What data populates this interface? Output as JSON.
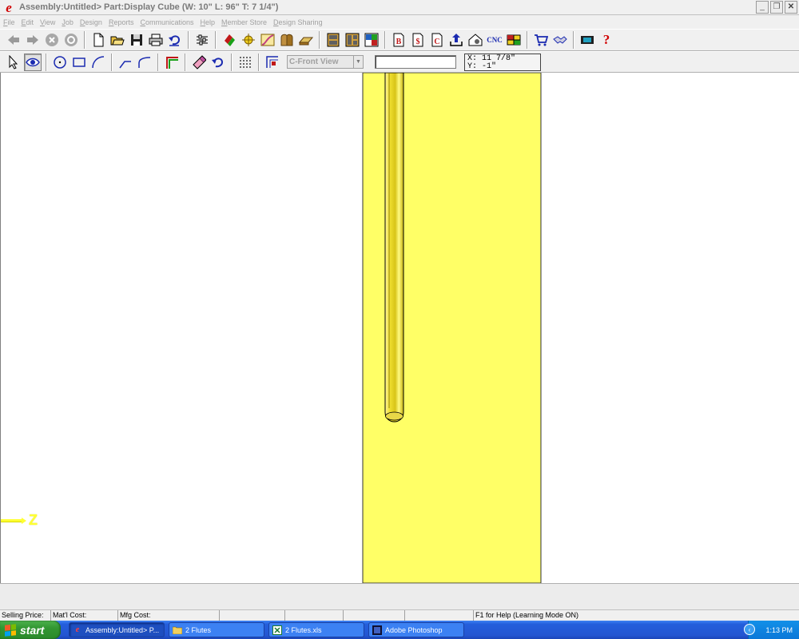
{
  "window": {
    "logo_letter": "e",
    "title": "Assembly:Untitled> Part:Display Cube (W: 10\" L: 96\" T: 7 1/4\")",
    "minimize": "_",
    "restore": "❐",
    "close": "✕"
  },
  "menu": [
    "File",
    "Edit",
    "View",
    "Job",
    "Design",
    "Reports",
    "Communications",
    "Help",
    "Member Store",
    "Design Sharing"
  ],
  "toolbar1": {
    "cnc_label": "CNC",
    "help_label": "?"
  },
  "toolbar2": {
    "view_select_value": "C-Front View",
    "input_value": "",
    "coord_x": "X: 11 7/8\"",
    "coord_y": "Y: -1\""
  },
  "canvas": {
    "axis_label": "Z",
    "part_color": "#ffff66",
    "background": "#ffffff"
  },
  "status": {
    "selling_price": "Selling Price:",
    "matl_cost": "Mat'l Cost:",
    "mfg_cost": "Mfg Cost:",
    "help_text": "F1 for Help (Learning Mode ON)"
  },
  "taskbar": {
    "start_label": "start",
    "tasks": [
      {
        "label": "Assembly:Untitled> P...",
        "icon": "e-app-icon",
        "active": true
      },
      {
        "label": "2 Flutes",
        "icon": "folder-icon",
        "active": false
      },
      {
        "label": "2 Flutes.xls",
        "icon": "excel-icon",
        "active": false
      },
      {
        "label": "Adobe Photoshop",
        "icon": "photoshop-icon",
        "active": false
      }
    ],
    "clock": "1:13 PM"
  }
}
